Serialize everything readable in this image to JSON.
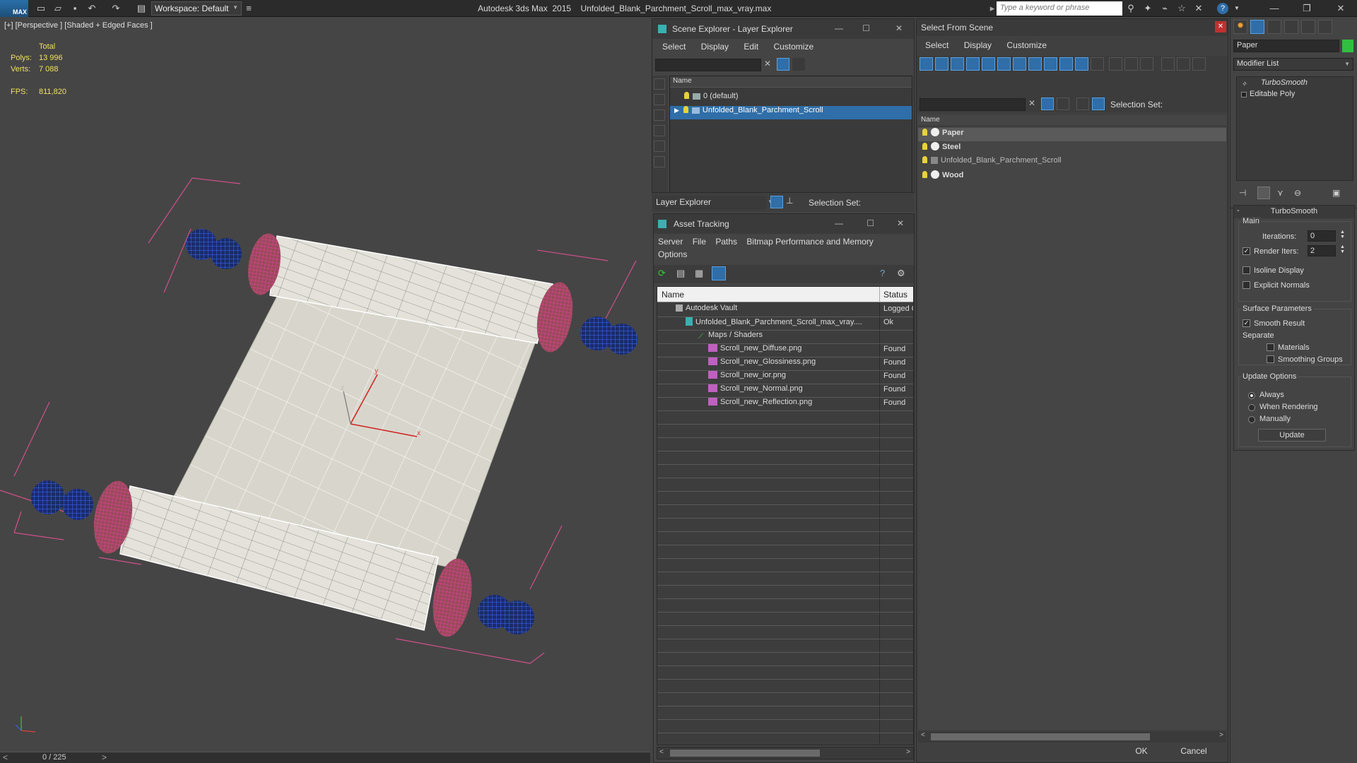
{
  "titlebar": {
    "logo_text": "MAX",
    "workspace": "Workspace: Default",
    "app_name": "Autodesk 3ds Max  2015",
    "file_name": "Unfolded_Blank_Parchment_Scroll_max_vray.max",
    "search_placeholder": "Type a keyword or phrase"
  },
  "viewport": {
    "label": "[+] [Perspective ] [Shaded + Edged Faces ]",
    "stats": {
      "total_label": "Total",
      "polys_label": "Polys:",
      "polys_value": "13 996",
      "verts_label": "Verts:",
      "verts_value": "7 088",
      "fps_label": "FPS:",
      "fps_value": "811,820"
    },
    "axis": {
      "x": "x",
      "y": "y",
      "z": "z"
    },
    "timeline": "0 / 225"
  },
  "scene_explorer": {
    "title": "Scene Explorer - Layer Explorer",
    "menu": [
      "Select",
      "Display",
      "Edit",
      "Customize"
    ],
    "column_name": "Name",
    "rows": [
      {
        "label": "0 (default)",
        "selected": false
      },
      {
        "label": "Unfolded_Blank_Parchment_Scroll",
        "selected": true
      }
    ],
    "footer_dropdown": "Layer Explorer",
    "selection_set_label": "Selection Set:"
  },
  "asset_tracking": {
    "title": "Asset Tracking",
    "menu": [
      "Server",
      "File",
      "Paths",
      "Bitmap Performance and Memory"
    ],
    "menu_second_line": "Options",
    "col_name": "Name",
    "col_status": "Status",
    "rows": [
      {
        "name": "Autodesk Vault",
        "status": "Logged O",
        "indent": 0
      },
      {
        "name": "Unfolded_Blank_Parchment_Scroll_max_vray....",
        "status": "Ok",
        "indent": 1
      },
      {
        "name": "Maps / Shaders",
        "status": "",
        "indent": 2
      },
      {
        "name": "Scroll_new_Diffuse.png",
        "status": "Found",
        "indent": 3
      },
      {
        "name": "Scroll_new_Glossiness.png",
        "status": "Found",
        "indent": 3
      },
      {
        "name": "Scroll_new_ior.png",
        "status": "Found",
        "indent": 3
      },
      {
        "name": "Scroll_new_Normal.png",
        "status": "Found",
        "indent": 3
      },
      {
        "name": "Scroll_new_Reflection.png",
        "status": "Found",
        "indent": 3
      }
    ]
  },
  "select_from_scene": {
    "title": "Select From Scene",
    "menu": [
      "Select",
      "Display",
      "Customize"
    ],
    "selection_set_label": "Selection Set:",
    "column_name": "Name",
    "rows": [
      {
        "label": "Paper",
        "bold": true,
        "selected": true
      },
      {
        "label": "Steel",
        "bold": true,
        "selected": false
      },
      {
        "label": "Unfolded_Blank_Parchment_Scroll",
        "bold": false,
        "selected": false
      },
      {
        "label": "Wood",
        "bold": true,
        "selected": false
      }
    ],
    "ok": "OK",
    "cancel": "Cancel"
  },
  "command_panel": {
    "object_name": "Paper",
    "modifier_list": "Modifier List",
    "stack": [
      "TurboSmooth",
      "Editable Poly"
    ],
    "rollout_title": "TurboSmooth",
    "main_group": "Main",
    "iterations_label": "Iterations:",
    "iterations_value": "0",
    "render_iters_label": "Render Iters:",
    "render_iters_value": "2",
    "isoline_label": "Isoline Display",
    "explicit_normals_label": "Explicit Normals",
    "surface_group": "Surface Parameters",
    "smooth_result_label": "Smooth Result",
    "separate_label": "Separate",
    "materials_label": "Materials",
    "smoothing_groups_label": "Smoothing Groups",
    "update_group": "Update Options",
    "always_label": "Always",
    "when_rendering_label": "When Rendering",
    "manually_label": "Manually",
    "update_button": "Update"
  },
  "colors": {
    "selection_blue": "#2f6ea8",
    "stat_yellow": "#f0e060",
    "wire_pink": "#e040a0",
    "wire_blue": "#3060e0"
  }
}
